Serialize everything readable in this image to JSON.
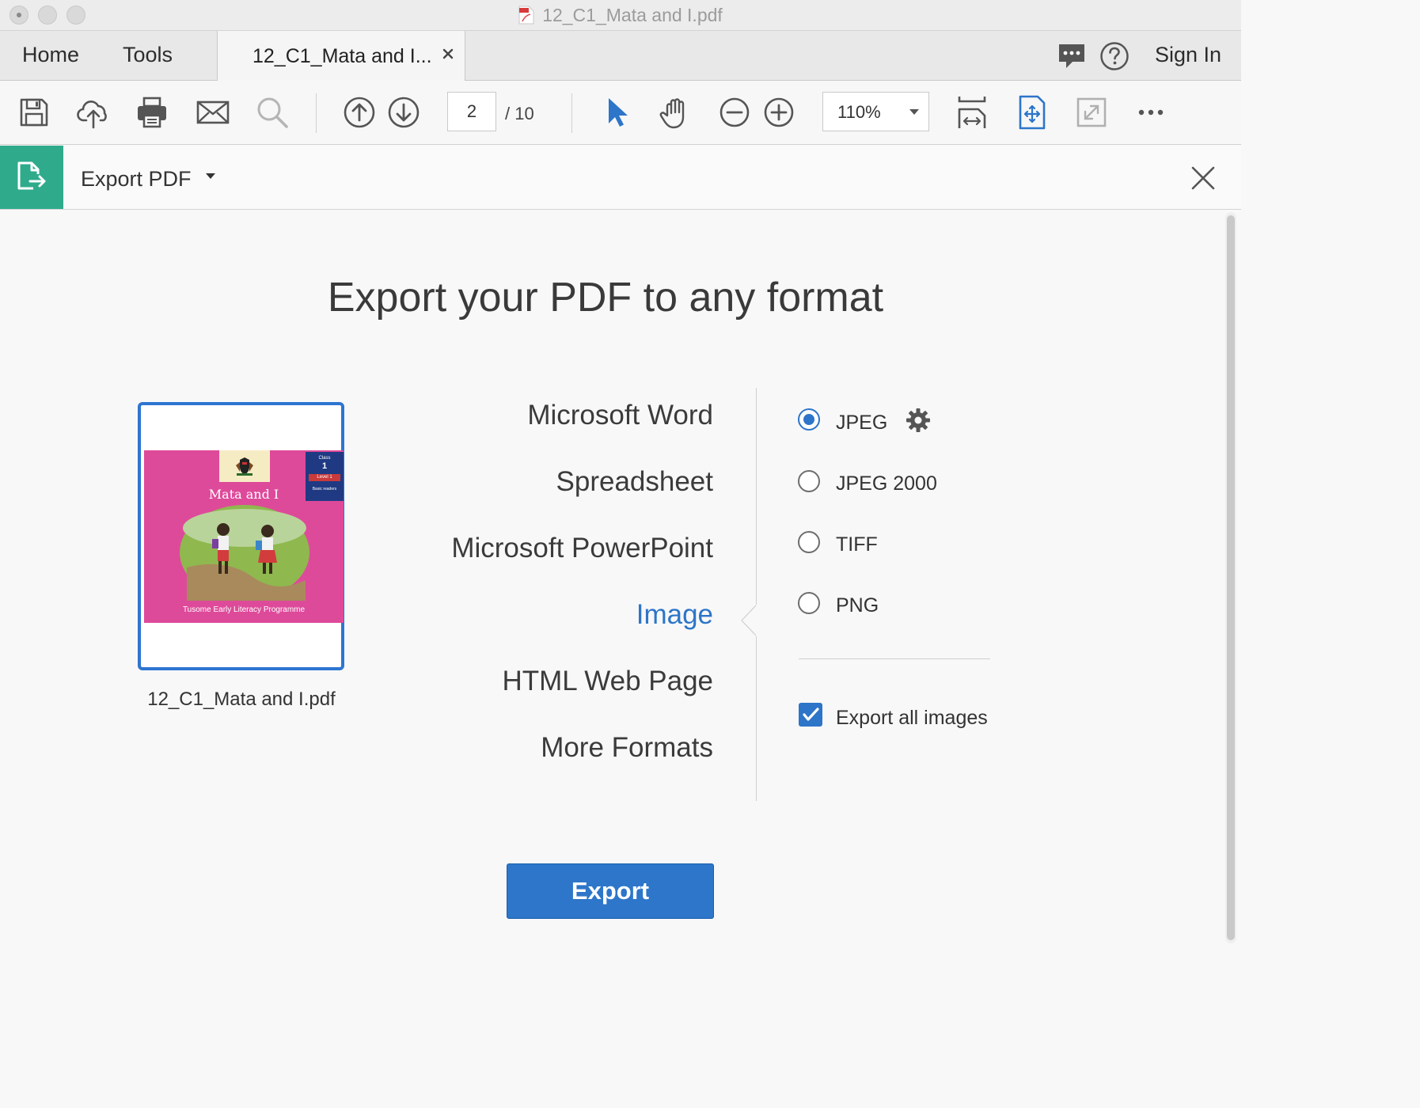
{
  "window": {
    "title": "12_C1_Mata and I.pdf"
  },
  "tabs": {
    "home": "Home",
    "tools": "Tools",
    "document": "12_C1_Mata and I...",
    "sign_in": "Sign In"
  },
  "toolbar": {
    "icons": [
      "save-icon",
      "upload-icon",
      "print-icon",
      "mail-icon",
      "search-icon",
      "prev-page-icon",
      "next-page-icon",
      "select-cursor-icon",
      "hand-tool-icon",
      "zoom-out-icon",
      "zoom-in-icon",
      "fit-page-icon",
      "scroll-mode-icon",
      "fullscreen-icon",
      "more-icon"
    ],
    "page_current": "2",
    "page_total": "/  10",
    "zoom": "110%"
  },
  "export_header": {
    "title": "Export PDF"
  },
  "panel": {
    "heading": "Export your PDF to any format",
    "file_name": "12_C1_Mata and I.pdf",
    "thumbnail": {
      "cover_title": "Mata and I",
      "cover_footer": "Tusome Early Literacy Programme",
      "badge_line1": "Class",
      "badge_line2": "1",
      "badge_line3": "Level 1",
      "badge_line4": "Basic readers"
    },
    "formats": [
      {
        "label": "Microsoft Word",
        "active": false
      },
      {
        "label": "Spreadsheet",
        "active": false
      },
      {
        "label": "Microsoft PowerPoint",
        "active": false
      },
      {
        "label": "Image",
        "active": true
      },
      {
        "label": "HTML Web Page",
        "active": false
      },
      {
        "label": "More Formats",
        "active": false
      }
    ],
    "image_options": [
      {
        "label": "JPEG",
        "selected": true
      },
      {
        "label": "JPEG 2000",
        "selected": false
      },
      {
        "label": "TIFF",
        "selected": false
      },
      {
        "label": "PNG",
        "selected": false
      }
    ],
    "export_all_images": {
      "label": "Export all images",
      "checked": true
    },
    "export_button": "Export"
  },
  "colors": {
    "accent": "#2d75c9",
    "export_tile": "#2fab8c",
    "cover_pink": "#de4a9a"
  }
}
